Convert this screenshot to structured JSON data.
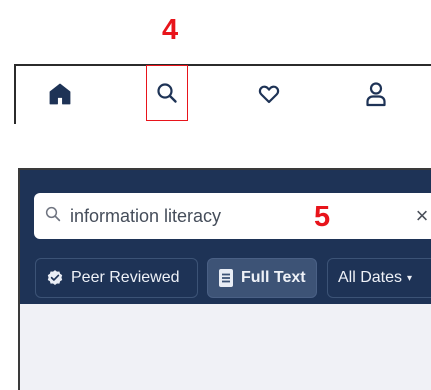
{
  "annotations": {
    "step_4": "4",
    "step_5": "5"
  },
  "colors": {
    "annotation_red": "#e8141b",
    "header_navy": "#1e3356",
    "chip_active": "#3d5376",
    "icon_dark": "#1e3356"
  },
  "nav": {
    "items": [
      {
        "id": "home",
        "icon": "home-icon"
      },
      {
        "id": "search",
        "icon": "search-icon",
        "highlighted": true
      },
      {
        "id": "favorites",
        "icon": "heart-icon"
      },
      {
        "id": "profile",
        "icon": "user-icon"
      }
    ]
  },
  "search": {
    "value": "information literacy",
    "clear_label": "×"
  },
  "filters": {
    "peer_reviewed": {
      "label": "Peer Reviewed",
      "icon": "check-badge-icon"
    },
    "full_text": {
      "label": "Full Text",
      "icon": "document-icon",
      "active": true
    },
    "all_dates": {
      "label": "All Dates",
      "icon": "caret-down-icon"
    }
  }
}
